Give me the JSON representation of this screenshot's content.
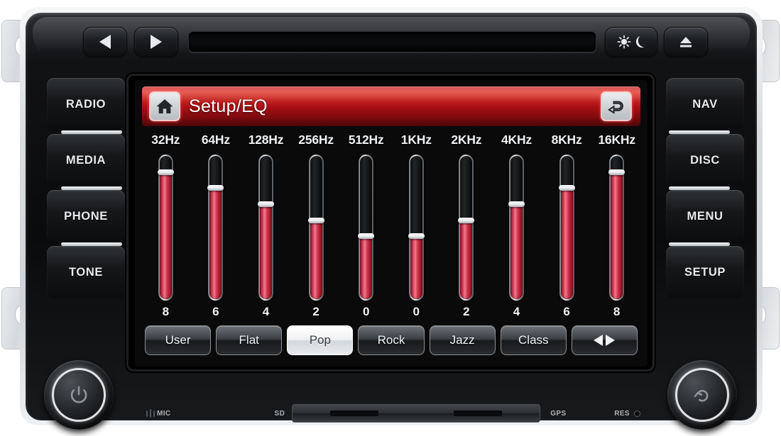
{
  "device": {
    "brand_surface": "car-head-unit",
    "top_controls": [
      {
        "name": "prev-track-button",
        "icon": "triangle-left-icon",
        "label": ""
      },
      {
        "name": "next-track-button",
        "icon": "triangle-right-icon",
        "label": ""
      },
      {
        "name": "day-night-button",
        "icon": "sun-moon-icon",
        "label": ""
      },
      {
        "name": "eject-button",
        "icon": "eject-icon",
        "label": ""
      }
    ],
    "left_buttons": [
      "RADIO",
      "MEDIA",
      "PHONE",
      "TONE"
    ],
    "right_buttons": [
      "NAV",
      "DISC",
      "MENU",
      "SETUP"
    ],
    "knobs": [
      {
        "name": "power-volume-knob",
        "icon": "power-icon"
      },
      {
        "name": "tune-scroll-knob",
        "icon": "return-arrow-icon"
      }
    ],
    "bottom_strip": {
      "mic_label": "MIC",
      "sd_label": "SD",
      "gps_label": "GPS",
      "res_label": "RES"
    }
  },
  "screen": {
    "header": {
      "title": "Setup/EQ",
      "home_icon": "home-icon",
      "back_icon": "back-arrow-icon",
      "accent_color": "#b81218"
    },
    "presets": [
      {
        "label": "User",
        "selected": false
      },
      {
        "label": "Flat",
        "selected": false
      },
      {
        "label": "Pop",
        "selected": true
      },
      {
        "label": "Rock",
        "selected": false
      },
      {
        "label": "Jazz",
        "selected": false
      },
      {
        "label": "Class",
        "selected": false
      }
    ],
    "balance_button": {
      "name": "balance-fader-button",
      "icon": "balance-icon"
    }
  },
  "chart_data": {
    "type": "bar",
    "title": "Setup/EQ",
    "xlabel": "",
    "ylabel": "",
    "ylim": [
      0,
      10
    ],
    "grid": false,
    "legend": "none",
    "categories": [
      "32Hz",
      "64Hz",
      "128Hz",
      "256Hz",
      "512Hz",
      "1KHz",
      "2KHz",
      "4KHz",
      "8KHz",
      "16KHz"
    ],
    "values": [
      8,
      6,
      4,
      2,
      0,
      0,
      2,
      4,
      6,
      8
    ],
    "value_labels": [
      "8",
      "6",
      "4",
      "2",
      "0",
      "0",
      "2",
      "4",
      "6",
      "8"
    ],
    "fill_percent": [
      88,
      77,
      66,
      55,
      44,
      44,
      55,
      66,
      77,
      88
    ],
    "bar_color": "#d3455c",
    "track_color": "#151719"
  }
}
